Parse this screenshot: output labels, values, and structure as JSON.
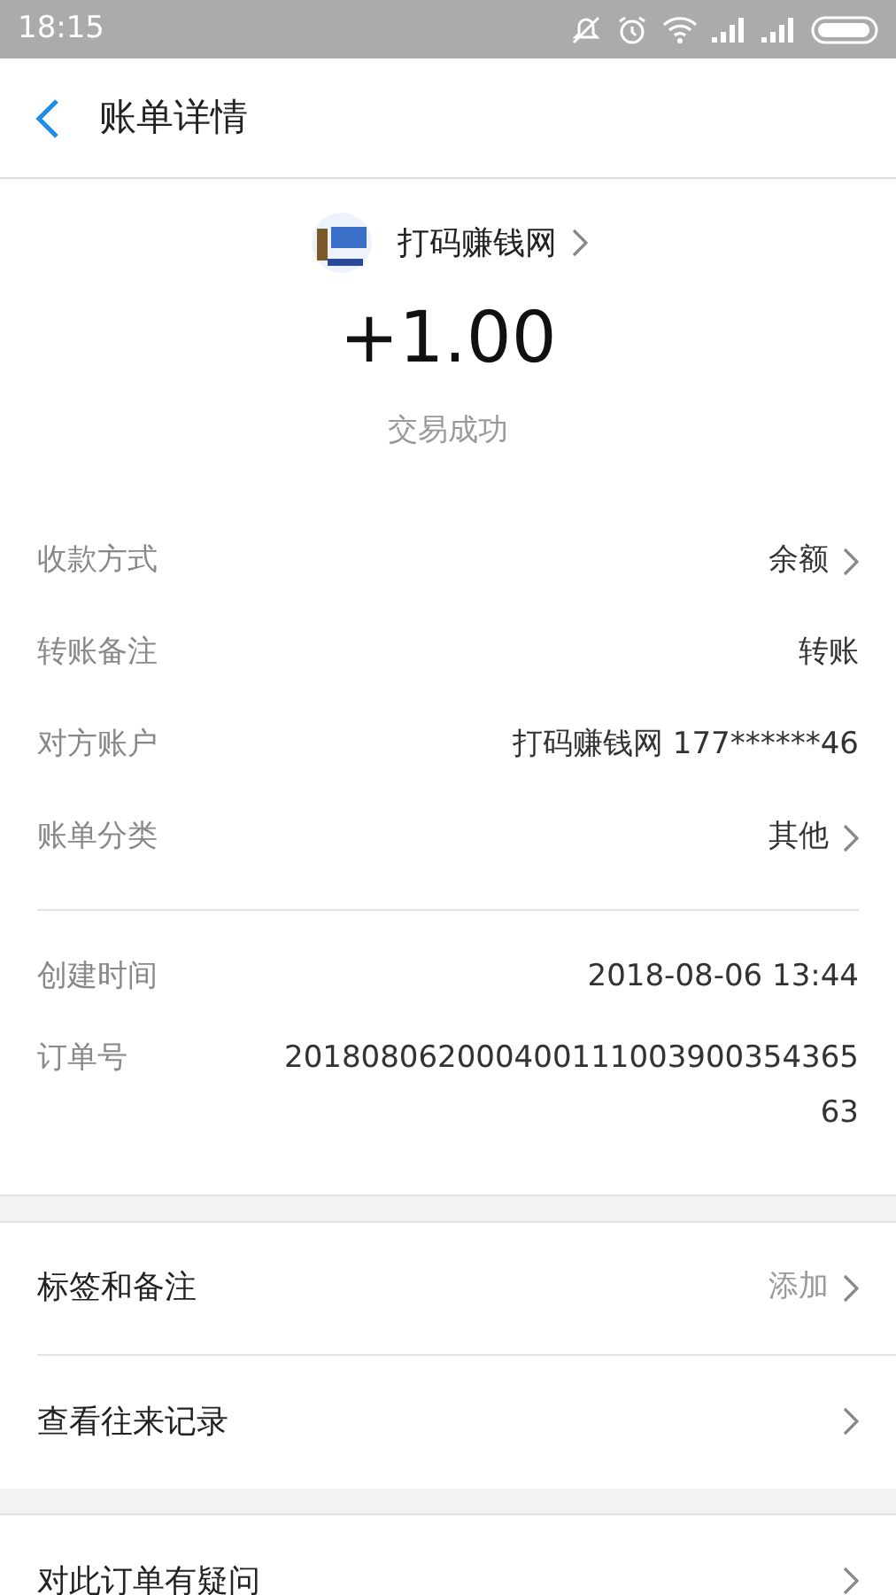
{
  "status_bar": {
    "time": "18:15"
  },
  "header": {
    "title": "账单详情"
  },
  "merchant": {
    "name": "打码赚钱网",
    "amount": "+1.00",
    "status": "交易成功"
  },
  "details": [
    {
      "label": "收款方式",
      "value": "余额",
      "arrow": true
    },
    {
      "label": "转账备注",
      "value": "转账",
      "arrow": false
    },
    {
      "label": "对方账户",
      "value": "打码赚钱网 177******46",
      "arrow": false
    },
    {
      "label": "账单分类",
      "value": "其他",
      "arrow": true
    }
  ],
  "times": [
    {
      "label": "创建时间",
      "value": "2018-08-06 13:44"
    },
    {
      "label": "订单号",
      "value": "20180806200040011100390035436563"
    }
  ],
  "action_groups": [
    [
      {
        "label": "标签和备注",
        "value": "添加"
      },
      {
        "label": "查看往来记录"
      }
    ],
    [
      {
        "label": "对此订单有疑问"
      }
    ]
  ]
}
